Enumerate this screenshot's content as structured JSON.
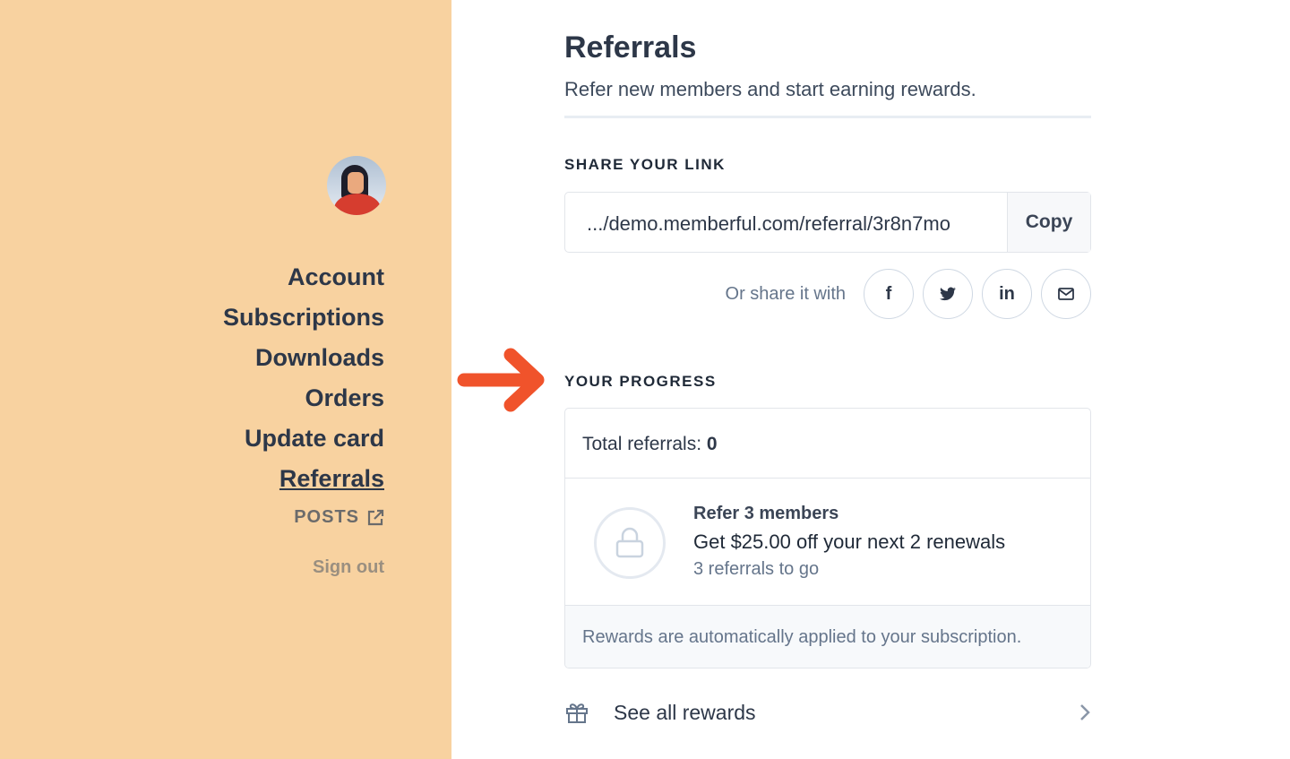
{
  "sidebar": {
    "items": [
      {
        "label": "Account"
      },
      {
        "label": "Subscriptions"
      },
      {
        "label": "Downloads"
      },
      {
        "label": "Orders"
      },
      {
        "label": "Update card"
      },
      {
        "label": "Referrals",
        "active": true
      }
    ],
    "posts": "POSTS",
    "signout": "Sign out",
    "background": "#f8d2a0"
  },
  "header": {
    "title": "Referrals",
    "subtitle": "Refer new members and start earning rewards."
  },
  "share": {
    "label": "SHARE YOUR LINK",
    "url": ".../demo.memberful.com/referral/3r8n7mo",
    "copy": "Copy",
    "share_with": "Or share it with",
    "icons": [
      "facebook-icon",
      "twitter-icon",
      "linkedin-icon",
      "email-icon"
    ]
  },
  "progress": {
    "label": "YOUR PROGRESS",
    "total_label": "Total referrals: ",
    "total_value": "0",
    "reward_title": "Refer 3 members",
    "reward_desc": "Get $25.00 off your next 2 renewals",
    "reward_remaining": "3 referrals to go",
    "note": "Rewards are automatically applied to your subscription."
  },
  "see_all": "See all rewards",
  "accent": "#f0532b"
}
